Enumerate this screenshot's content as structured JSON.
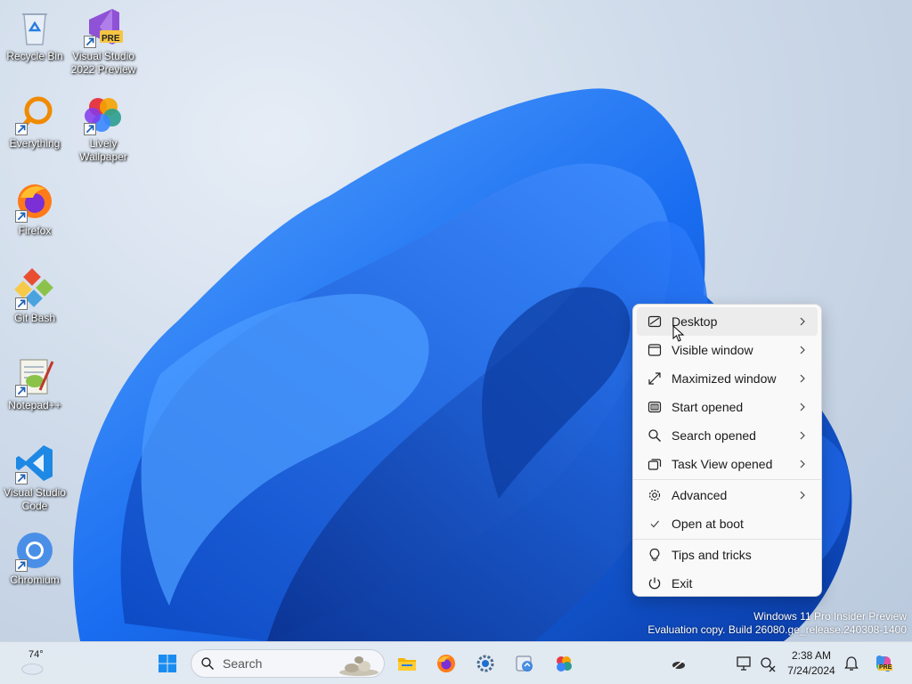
{
  "desktop_icons": [
    {
      "label": "Recycle Bin",
      "icon": "recycle-bin-icon"
    },
    {
      "label": "Visual Studio 2022 Preview",
      "icon": "visual-studio-icon",
      "badge": "PRE"
    },
    {
      "label": "Everything",
      "icon": "everything-icon"
    },
    {
      "label": "Lively Wallpaper",
      "icon": "lively-wallpaper-icon"
    },
    {
      "label": "Firefox",
      "icon": "firefox-icon"
    },
    {
      "label": "Git Bash",
      "icon": "git-bash-icon"
    },
    {
      "label": "Notepad++",
      "icon": "notepad-plus-plus-icon"
    },
    {
      "label": "Visual Studio Code",
      "icon": "vscode-icon"
    },
    {
      "label": "Chromium",
      "icon": "chromium-icon"
    }
  ],
  "context_menu": {
    "items": [
      {
        "label": "Desktop",
        "icon": "desktop-icon"
      },
      {
        "label": "Visible window",
        "icon": "window-icon"
      },
      {
        "label": "Maximized window",
        "icon": "maximize-icon"
      },
      {
        "label": "Start opened",
        "icon": "start-menu-icon"
      },
      {
        "label": "Search opened",
        "icon": "search-icon"
      },
      {
        "label": "Task View opened",
        "icon": "task-view-icon"
      },
      {
        "label": "Advanced",
        "icon": "gear-icon"
      },
      {
        "label": "Open at boot",
        "icon": "check-icon"
      },
      {
        "label": "Tips and tricks",
        "icon": "lightbulb-icon"
      },
      {
        "label": "Exit",
        "icon": "power-icon"
      }
    ]
  },
  "watermark": {
    "line1": "Windows 11 Pro Insider Preview",
    "line2": "Evaluation copy. Build 26080.ge_release.240308-1400"
  },
  "taskbar": {
    "weather_temp": "74°",
    "search_placeholder": "Search",
    "clock_time": "2:38 AM",
    "clock_date": "7/24/2024",
    "copilot_badge": "PRE"
  },
  "colors": {
    "accent": "#0067c0",
    "menu_bg": "#f9f9f9",
    "taskbar_bg": "#e2e9f2"
  }
}
